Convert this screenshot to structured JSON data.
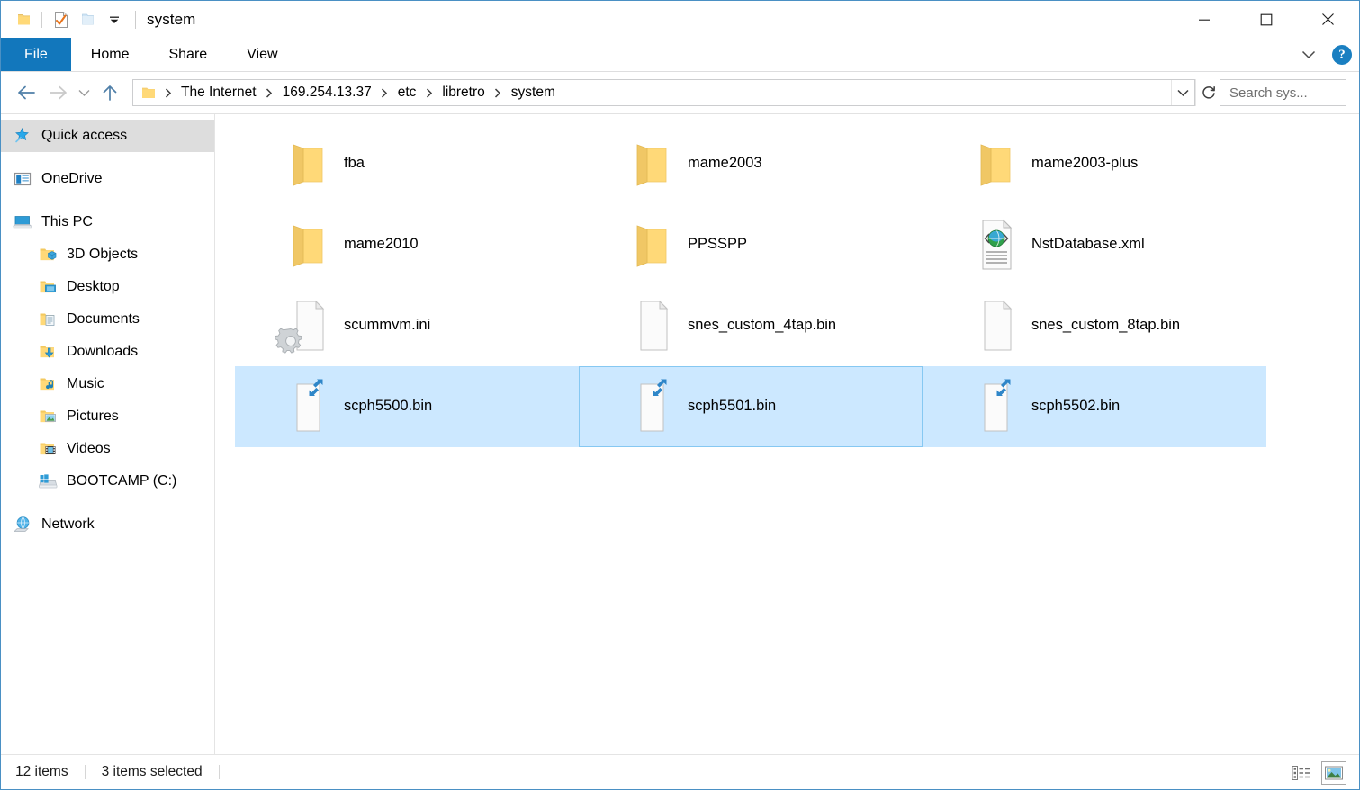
{
  "window": {
    "title": "system",
    "quick_access_toolbar": [
      {
        "name": "folder-icon",
        "label": "Folder"
      },
      {
        "name": "properties-icon",
        "label": "Properties"
      },
      {
        "name": "new-folder-icon",
        "label": "New folder"
      },
      {
        "name": "chevron-down-icon",
        "label": "Customize Quick Access Toolbar"
      }
    ],
    "controls": {
      "minimize": "Minimize",
      "maximize": "Maximize",
      "close": "Close"
    }
  },
  "ribbon": {
    "tabs": [
      {
        "label": "File",
        "active": true
      },
      {
        "label": "Home",
        "active": false
      },
      {
        "label": "Share",
        "active": false
      },
      {
        "label": "View",
        "active": false
      }
    ],
    "expand_label": "Expand the Ribbon",
    "help_label": "?"
  },
  "addressbar": {
    "back_label": "Back",
    "forward_label": "Forward",
    "recent_label": "Recent locations",
    "up_label": "Up",
    "breadcrumbs": [
      "The Internet",
      "169.254.13.37",
      "etc",
      "libretro",
      "system"
    ],
    "dropdown_label": "Previous locations",
    "refresh_label": "Refresh"
  },
  "search": {
    "placeholder": "Search sys...",
    "value": ""
  },
  "sidebar": {
    "items": [
      {
        "label": "Quick access",
        "icon": "star-pin-icon",
        "indent": 0,
        "selected": true
      },
      {
        "label": "OneDrive",
        "icon": "onedrive-icon",
        "indent": 0,
        "selected": false
      },
      {
        "label": "This PC",
        "icon": "this-pc-icon",
        "indent": 0,
        "selected": false
      },
      {
        "label": "3D Objects",
        "icon": "folder-3d-icon",
        "indent": 1,
        "selected": false
      },
      {
        "label": "Desktop",
        "icon": "folder-desktop-icon",
        "indent": 1,
        "selected": false
      },
      {
        "label": "Documents",
        "icon": "folder-documents-icon",
        "indent": 1,
        "selected": false
      },
      {
        "label": "Downloads",
        "icon": "folder-downloads-icon",
        "indent": 1,
        "selected": false
      },
      {
        "label": "Music",
        "icon": "folder-music-icon",
        "indent": 1,
        "selected": false
      },
      {
        "label": "Pictures",
        "icon": "folder-pictures-icon",
        "indent": 1,
        "selected": false
      },
      {
        "label": "Videos",
        "icon": "folder-videos-icon",
        "indent": 1,
        "selected": false
      },
      {
        "label": "BOOTCAMP (C:)",
        "icon": "drive-windows-icon",
        "indent": 1,
        "selected": false
      },
      {
        "label": "Network",
        "icon": "network-icon",
        "indent": 0,
        "selected": false
      }
    ]
  },
  "files": [
    {
      "name": "fba",
      "type": "folder",
      "selected": false,
      "focused": false
    },
    {
      "name": "mame2003",
      "type": "folder",
      "selected": false,
      "focused": false
    },
    {
      "name": "mame2003-plus",
      "type": "folder",
      "selected": false,
      "focused": false
    },
    {
      "name": "mame2010",
      "type": "folder",
      "selected": false,
      "focused": false
    },
    {
      "name": "PPSSPP",
      "type": "folder",
      "selected": false,
      "focused": false
    },
    {
      "name": "NstDatabase.xml",
      "type": "xml",
      "selected": false,
      "focused": false
    },
    {
      "name": "scummvm.ini",
      "type": "ini",
      "selected": false,
      "focused": false
    },
    {
      "name": "snes_custom_4tap.bin",
      "type": "blank",
      "selected": false,
      "focused": false
    },
    {
      "name": "snes_custom_8tap.bin",
      "type": "blank",
      "selected": false,
      "focused": false
    },
    {
      "name": "scph5500.bin",
      "type": "shortcut",
      "selected": true,
      "focused": false
    },
    {
      "name": "scph5501.bin",
      "type": "shortcut",
      "selected": true,
      "focused": true
    },
    {
      "name": "scph5502.bin",
      "type": "shortcut",
      "selected": true,
      "focused": false
    }
  ],
  "statusbar": {
    "item_count": "12 items",
    "selection_count": "3 items selected",
    "details_view_label": "Details view",
    "large_icons_view_label": "Large icons view"
  },
  "colors": {
    "accent": "#1277bc",
    "selection": "#cce8ff",
    "focus_border": "#86c8f2",
    "folder_yellow": "#ffd75e",
    "window_border": "#4a90c4"
  }
}
